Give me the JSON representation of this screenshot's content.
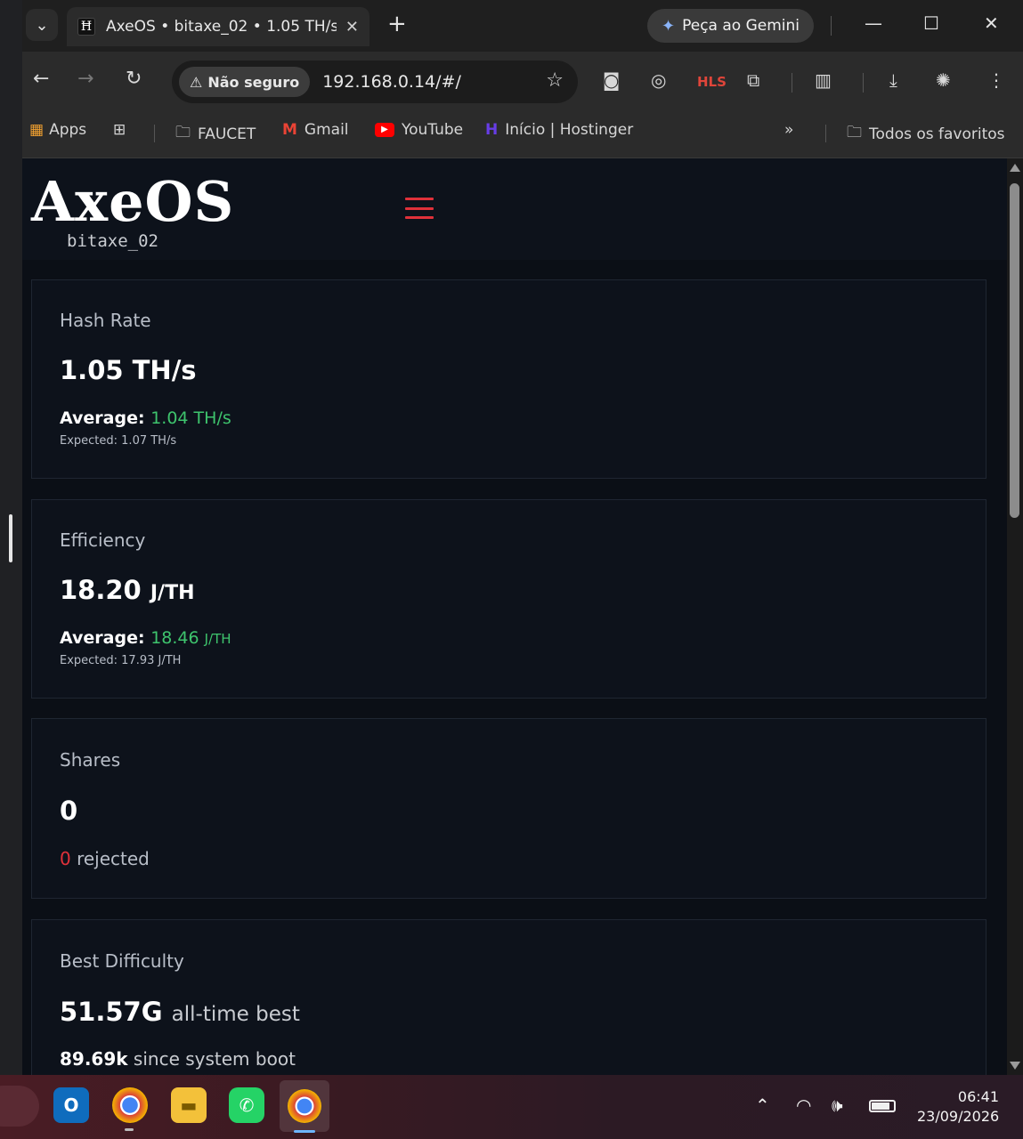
{
  "browser": {
    "tab_title": "AxeOS • bitaxe_02 • 1.05 TH/s •",
    "tab_favicon": "Ħ",
    "gemini_label": "Peça ao Gemini",
    "security_label": "Não seguro",
    "url": "192.168.0.14/#/",
    "bookmarks": {
      "apps": "Apps",
      "faucet": "FAUCET",
      "gmail": "Gmail",
      "youtube": "YouTube",
      "hostinger": "Início | Hostinger",
      "all": "Todos os favoritos"
    }
  },
  "app": {
    "logo": "AxeOS",
    "hostname": "bitaxe_02",
    "accent_color": "#e0313a",
    "positive_color": "#3ec46d"
  },
  "cards": {
    "hashrate": {
      "label": "Hash Rate",
      "value": "1.05 TH/s",
      "avg_prefix": "Average:",
      "avg_value": "1.04 TH/s",
      "expected": "Expected: 1.07 TH/s"
    },
    "efficiency": {
      "label": "Efficiency",
      "value": "18.20",
      "unit": "J/TH",
      "avg_prefix": "Average:",
      "avg_value": "18.46",
      "avg_unit": "J/TH",
      "expected": "Expected: 17.93 J/TH"
    },
    "shares": {
      "label": "Shares",
      "value": "0",
      "rejected_count": "0",
      "rejected_label": "rejected"
    },
    "best_difficulty": {
      "label": "Best Difficulty",
      "value": "51.57G",
      "value_suffix": "all-time best",
      "since_value": "89.69k",
      "since_label": "since system boot"
    }
  },
  "taskbar": {
    "time": "06:41",
    "date": "23/09/2026"
  }
}
